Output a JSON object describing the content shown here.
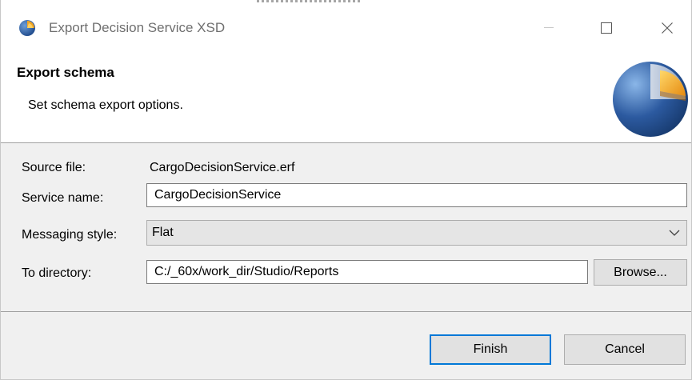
{
  "window": {
    "title": "Export Decision Service XSD",
    "controls": {
      "minimize_icon": "minimize-icon",
      "maximize_icon": "maximize-icon",
      "close_icon": "close-icon"
    }
  },
  "banner": {
    "title": "Export schema",
    "description": "Set schema export options.",
    "logo_icon": "pie-chart-logo-icon"
  },
  "form": {
    "source_file": {
      "label": "Source file:",
      "value": "CargoDecisionService.erf"
    },
    "service_name": {
      "label": "Service name:",
      "value": "CargoDecisionService"
    },
    "messaging_style": {
      "label": "Messaging style:",
      "selected": "Flat"
    },
    "to_directory": {
      "label": "To directory:",
      "value": "C:/_60x/work_dir/Studio/Reports",
      "browse_label": "Browse..."
    }
  },
  "footer": {
    "finish_label": "Finish",
    "cancel_label": "Cancel"
  },
  "colors": {
    "accent": "#0078d7",
    "dialog_bg": "#f0f0f0",
    "logo_blue": "#2c5aa0",
    "logo_orange": "#f0a020"
  }
}
